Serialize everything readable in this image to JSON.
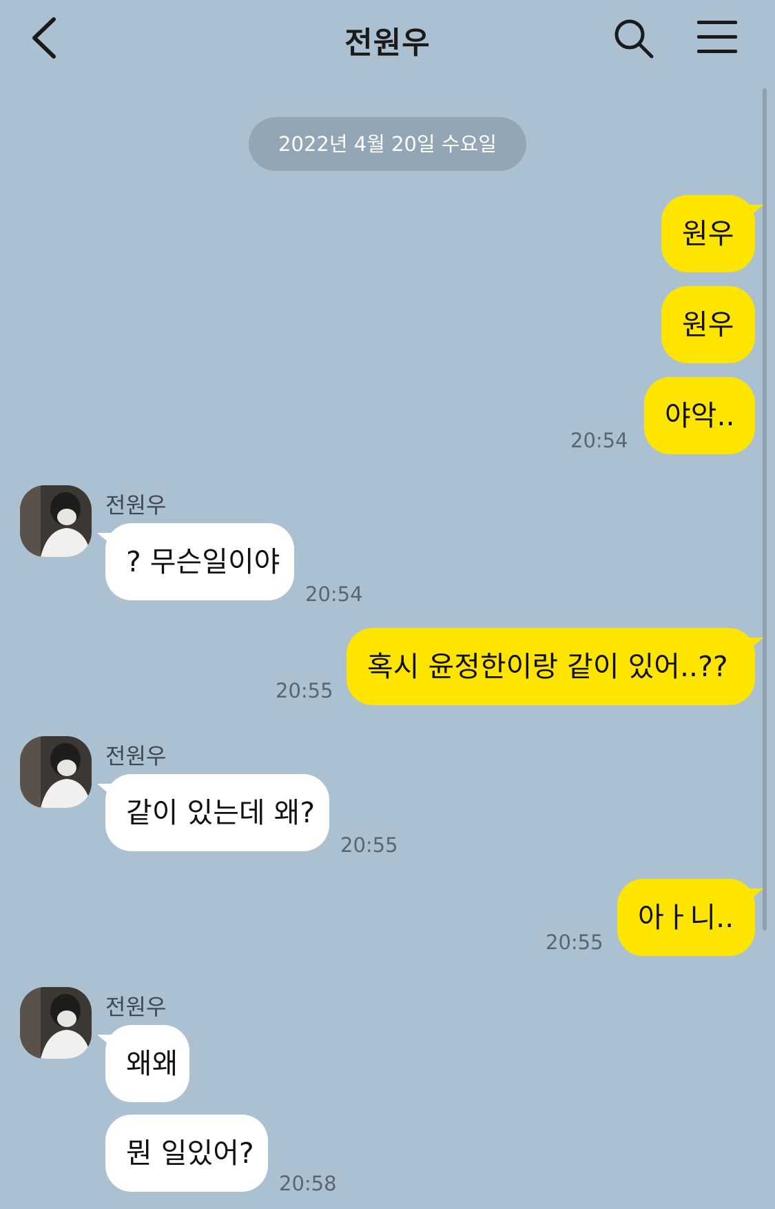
{
  "header": {
    "title": "전원우"
  },
  "date_divider": "2022년 4월 20일 수요일",
  "contact_name": "전원우",
  "messages": [
    {
      "text": "원우"
    },
    {
      "text": "원우"
    },
    {
      "text": "야악..",
      "time": "20:54"
    },
    {
      "text": "? 무슨일이야",
      "time": "20:54"
    },
    {
      "text": "혹시 윤정한이랑 같이 있어..??",
      "time": "20:55"
    },
    {
      "text": "같이 있는데 왜?",
      "time": "20:55"
    },
    {
      "text": "아ㅏ니..",
      "time": "20:55"
    },
    {
      "text": "왜왜"
    },
    {
      "text": "뭔 일있어?",
      "time": "20:58"
    }
  ],
  "colors": {
    "background": "#abc1d1",
    "my_bubble": "#fee500",
    "their_bubble": "#ffffff"
  },
  "icons": [
    "back-arrow-icon",
    "search-icon",
    "hamburger-menu-icon",
    "profile-avatar"
  ]
}
